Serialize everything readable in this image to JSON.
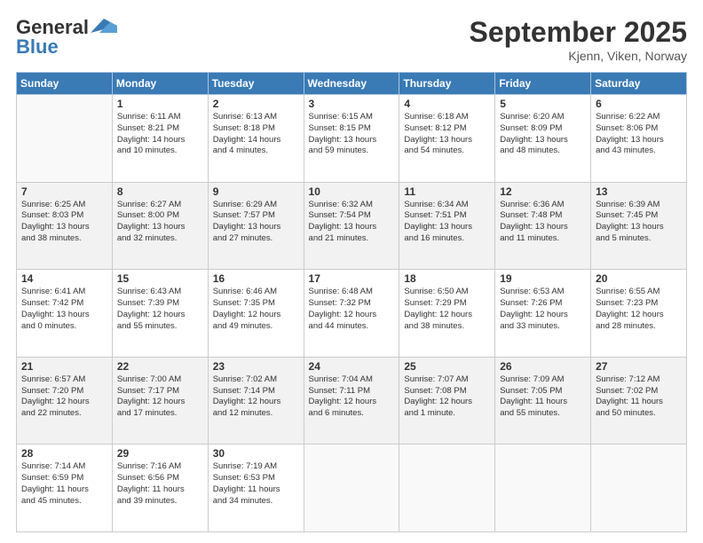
{
  "header": {
    "logo_line1": "General",
    "logo_line2": "Blue",
    "month_title": "September 2025",
    "location": "Kjenn, Viken, Norway"
  },
  "days_of_week": [
    "Sunday",
    "Monday",
    "Tuesday",
    "Wednesday",
    "Thursday",
    "Friday",
    "Saturday"
  ],
  "weeks": [
    [
      {
        "day": "",
        "detail": ""
      },
      {
        "day": "1",
        "detail": "Sunrise: 6:11 AM\nSunset: 8:21 PM\nDaylight: 14 hours\nand 10 minutes."
      },
      {
        "day": "2",
        "detail": "Sunrise: 6:13 AM\nSunset: 8:18 PM\nDaylight: 14 hours\nand 4 minutes."
      },
      {
        "day": "3",
        "detail": "Sunrise: 6:15 AM\nSunset: 8:15 PM\nDaylight: 13 hours\nand 59 minutes."
      },
      {
        "day": "4",
        "detail": "Sunrise: 6:18 AM\nSunset: 8:12 PM\nDaylight: 13 hours\nand 54 minutes."
      },
      {
        "day": "5",
        "detail": "Sunrise: 6:20 AM\nSunset: 8:09 PM\nDaylight: 13 hours\nand 48 minutes."
      },
      {
        "day": "6",
        "detail": "Sunrise: 6:22 AM\nSunset: 8:06 PM\nDaylight: 13 hours\nand 43 minutes."
      }
    ],
    [
      {
        "day": "7",
        "detail": "Sunrise: 6:25 AM\nSunset: 8:03 PM\nDaylight: 13 hours\nand 38 minutes."
      },
      {
        "day": "8",
        "detail": "Sunrise: 6:27 AM\nSunset: 8:00 PM\nDaylight: 13 hours\nand 32 minutes."
      },
      {
        "day": "9",
        "detail": "Sunrise: 6:29 AM\nSunset: 7:57 PM\nDaylight: 13 hours\nand 27 minutes."
      },
      {
        "day": "10",
        "detail": "Sunrise: 6:32 AM\nSunset: 7:54 PM\nDaylight: 13 hours\nand 21 minutes."
      },
      {
        "day": "11",
        "detail": "Sunrise: 6:34 AM\nSunset: 7:51 PM\nDaylight: 13 hours\nand 16 minutes."
      },
      {
        "day": "12",
        "detail": "Sunrise: 6:36 AM\nSunset: 7:48 PM\nDaylight: 13 hours\nand 11 minutes."
      },
      {
        "day": "13",
        "detail": "Sunrise: 6:39 AM\nSunset: 7:45 PM\nDaylight: 13 hours\nand 5 minutes."
      }
    ],
    [
      {
        "day": "14",
        "detail": "Sunrise: 6:41 AM\nSunset: 7:42 PM\nDaylight: 13 hours\nand 0 minutes."
      },
      {
        "day": "15",
        "detail": "Sunrise: 6:43 AM\nSunset: 7:39 PM\nDaylight: 12 hours\nand 55 minutes."
      },
      {
        "day": "16",
        "detail": "Sunrise: 6:46 AM\nSunset: 7:35 PM\nDaylight: 12 hours\nand 49 minutes."
      },
      {
        "day": "17",
        "detail": "Sunrise: 6:48 AM\nSunset: 7:32 PM\nDaylight: 12 hours\nand 44 minutes."
      },
      {
        "day": "18",
        "detail": "Sunrise: 6:50 AM\nSunset: 7:29 PM\nDaylight: 12 hours\nand 38 minutes."
      },
      {
        "day": "19",
        "detail": "Sunrise: 6:53 AM\nSunset: 7:26 PM\nDaylight: 12 hours\nand 33 minutes."
      },
      {
        "day": "20",
        "detail": "Sunrise: 6:55 AM\nSunset: 7:23 PM\nDaylight: 12 hours\nand 28 minutes."
      }
    ],
    [
      {
        "day": "21",
        "detail": "Sunrise: 6:57 AM\nSunset: 7:20 PM\nDaylight: 12 hours\nand 22 minutes."
      },
      {
        "day": "22",
        "detail": "Sunrise: 7:00 AM\nSunset: 7:17 PM\nDaylight: 12 hours\nand 17 minutes."
      },
      {
        "day": "23",
        "detail": "Sunrise: 7:02 AM\nSunset: 7:14 PM\nDaylight: 12 hours\nand 12 minutes."
      },
      {
        "day": "24",
        "detail": "Sunrise: 7:04 AM\nSunset: 7:11 PM\nDaylight: 12 hours\nand 6 minutes."
      },
      {
        "day": "25",
        "detail": "Sunrise: 7:07 AM\nSunset: 7:08 PM\nDaylight: 12 hours\nand 1 minute."
      },
      {
        "day": "26",
        "detail": "Sunrise: 7:09 AM\nSunset: 7:05 PM\nDaylight: 11 hours\nand 55 minutes."
      },
      {
        "day": "27",
        "detail": "Sunrise: 7:12 AM\nSunset: 7:02 PM\nDaylight: 11 hours\nand 50 minutes."
      }
    ],
    [
      {
        "day": "28",
        "detail": "Sunrise: 7:14 AM\nSunset: 6:59 PM\nDaylight: 11 hours\nand 45 minutes."
      },
      {
        "day": "29",
        "detail": "Sunrise: 7:16 AM\nSunset: 6:56 PM\nDaylight: 11 hours\nand 39 minutes."
      },
      {
        "day": "30",
        "detail": "Sunrise: 7:19 AM\nSunset: 6:53 PM\nDaylight: 11 hours\nand 34 minutes."
      },
      {
        "day": "",
        "detail": ""
      },
      {
        "day": "",
        "detail": ""
      },
      {
        "day": "",
        "detail": ""
      },
      {
        "day": "",
        "detail": ""
      }
    ]
  ]
}
